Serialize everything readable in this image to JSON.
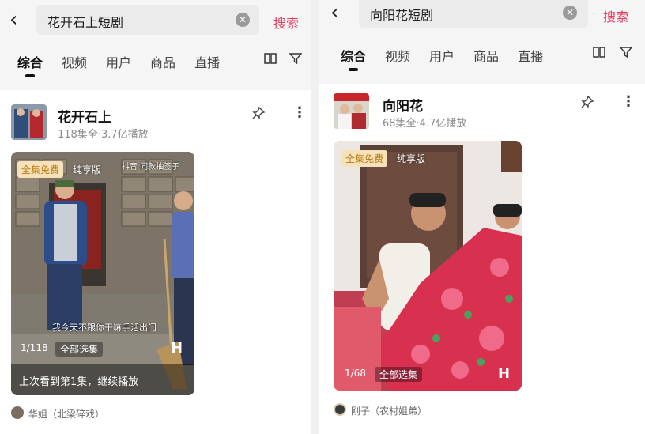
{
  "panels": [
    {
      "search": {
        "query": "花开石上短剧",
        "button": "搜索"
      },
      "tabs": [
        "综合",
        "视频",
        "用户",
        "商品",
        "直播"
      ],
      "result": {
        "title": "花开石上",
        "meta": "118集全·3.7亿播放",
        "badge": "全集免费",
        "pure": "纯享版",
        "episode": "1/118",
        "all_episodes": "全部选集",
        "resume": "上次看到第1集，继续播放",
        "subtitle": "我今天不跟你干嘛手活出门",
        "watermark": "抖音 同款抽签子",
        "author": "华姐（北梁碎戏）"
      }
    },
    {
      "search": {
        "query": "向阳花短剧",
        "button": "搜索"
      },
      "tabs": [
        "综合",
        "视频",
        "用户",
        "商品",
        "直播"
      ],
      "result": {
        "title": "向阳花",
        "meta": "68集全·4.7亿播放",
        "badge": "全集免费",
        "pure": "纯享版",
        "episode": "1/68",
        "all_episodes": "全部选集",
        "author": "刚子（农村姐弟）"
      }
    }
  ],
  "icons": {
    "back": "chevron-left-icon",
    "clear": "clear-icon",
    "grid": "grid-view-icon",
    "filter": "filter-icon",
    "pin": "pin-icon",
    "more": "more-vertical-icon"
  },
  "colors": {
    "accent": "#e8395a",
    "badge_bg": "#f6e1b8",
    "badge_text": "#b37a14"
  }
}
